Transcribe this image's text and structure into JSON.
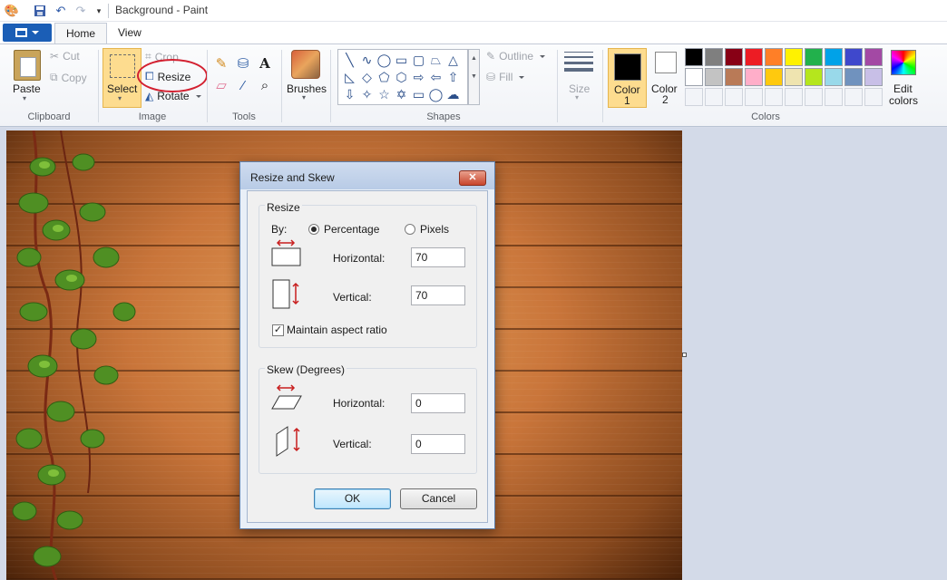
{
  "app": {
    "title": "Background - Paint",
    "quick_access": [
      "paint-app-icon",
      "save-icon",
      "undo-icon",
      "redo-icon",
      "customize-dropdown-icon"
    ]
  },
  "tabs": {
    "home": "Home",
    "view": "View"
  },
  "ribbon": {
    "clipboard": {
      "paste": "Paste",
      "cut": "Cut",
      "copy": "Copy",
      "group_label": "Clipboard"
    },
    "image": {
      "select": "Select",
      "crop": "Crop",
      "resize": "Resize",
      "rotate": "Rotate",
      "group_label": "Image"
    },
    "tools": {
      "group_label": "Tools",
      "items": [
        "pencil-icon",
        "fill-icon",
        "text-icon",
        "eraser-icon",
        "color-picker-icon",
        "magnifier-icon"
      ]
    },
    "brushes": {
      "label": "Brushes"
    },
    "shapes": {
      "outline": "Outline",
      "fill": "Fill",
      "group_label": "Shapes"
    },
    "size": {
      "label": "Size"
    },
    "colors": {
      "color1_label": "Color",
      "color1_index": "1",
      "color2_label": "Color",
      "color2_index": "2",
      "edit_label_1": "Edit",
      "edit_label_2": "colors",
      "group_label": "Colors",
      "color1": "#000000",
      "color2": "#ffffff",
      "palette_row1": [
        "#000000",
        "#7f7f7f",
        "#880015",
        "#ed1c24",
        "#ff7f27",
        "#fff200",
        "#22b14c",
        "#00a2e8",
        "#3f48cc",
        "#a349a4"
      ],
      "palette_row2": [
        "#ffffff",
        "#c3c3c3",
        "#b97a57",
        "#ffaec9",
        "#ffc90e",
        "#efe4b0",
        "#b5e61d",
        "#99d9ea",
        "#7092be",
        "#c8bfe7"
      ]
    }
  },
  "dialog": {
    "title": "Resize and Skew",
    "close": "✕",
    "resize": {
      "caption": "Resize",
      "by_label": "By:",
      "percentage_label": "Percentage",
      "pixels_label": "Pixels",
      "selected_unit": "Percentage",
      "horizontal_label": "Horizontal:",
      "horizontal_value": "70",
      "vertical_label": "Vertical:",
      "vertical_value": "70",
      "maintain_aspect_label": "Maintain aspect ratio",
      "maintain_aspect_checked": true
    },
    "skew": {
      "caption": "Skew (Degrees)",
      "horizontal_label": "Horizontal:",
      "horizontal_value": "0",
      "vertical_label": "Vertical:",
      "vertical_value": "0"
    },
    "ok_label": "OK",
    "cancel_label": "Cancel"
  }
}
